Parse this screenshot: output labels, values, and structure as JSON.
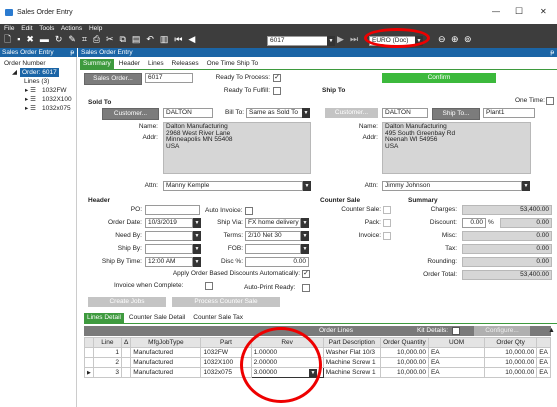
{
  "window": {
    "title": "Sales Order Entry",
    "min": "—",
    "max": "☐",
    "close": "✕"
  },
  "menu": [
    "File",
    "Edit",
    "Tools",
    "Actions",
    "Help"
  ],
  "toolbar": {
    "order_num": "6017",
    "currency": "EURO (Doc)"
  },
  "tree": {
    "header": "Sales Order Entry",
    "pin": "ᵽ",
    "order_number": "Order Number",
    "order": "Order: 6017",
    "lines": "Lines (3)",
    "items": [
      "1032FW",
      "1032X100",
      "1032x075"
    ]
  },
  "main": {
    "header": "Sales Order Entry",
    "pin": "ᵽ"
  },
  "tabs": [
    "Summary",
    "Header",
    "Lines",
    "Releases",
    "One Time Ship To"
  ],
  "top": {
    "sales_order_btn": "Sales Order...",
    "sales_order": "6017",
    "ready_to_process": "Ready To Process:",
    "ready_to_fulfill": "Ready To Fulfill:",
    "confirm": "Confirm",
    "check": "✓"
  },
  "sold_to": {
    "title": "Sold To",
    "customer_btn": "Customer...",
    "customer": "DALTON",
    "bill_to_label": "Bill To:",
    "bill_to": "Same as Sold To",
    "name_label": "Name:",
    "name": "Dalton Manufacturing",
    "addr_label": "Addr:",
    "addr1": "2968 West River Lane",
    "addr2": "Minneapolis MN 55408",
    "addr3": "USA",
    "attn_label": "Attn:",
    "attn": "Manny Kemple"
  },
  "ship_to": {
    "title": "Ship To",
    "one_time": "One Time:",
    "customer_btn": "Customer...",
    "customer": "DALTON",
    "ship_to_btn": "Ship To...",
    "ship_to": "Plant1",
    "name_label": "Name:",
    "name": "Dalton Manufacturing",
    "addr_label": "Addr:",
    "addr1": "495 South Greenbay Rd",
    "addr2": "Neenah WI 54956",
    "addr3": "USA",
    "attn_label": "Attn:",
    "attn": "Jimmy Johnson"
  },
  "header": {
    "title": "Header",
    "po_label": "PO:",
    "po": "",
    "auto_invoice": "Auto Invoice:",
    "order_date_label": "Order Date:",
    "order_date": "10/3/2019",
    "ship_via_label": "Ship Via:",
    "ship_via": "FX home delivery",
    "need_by_label": "Need By:",
    "terms_label": "Terms:",
    "terms": "2/10 Net 30",
    "ship_by_label": "Ship By:",
    "fob_label": "FOB:",
    "ship_by_time_label": "Ship By Time:",
    "ship_by_time": "12:00 AM",
    "disc_label": "Disc %:",
    "disc": "0.00",
    "apply_discounts": "Apply Order Based Discounts Automatically:",
    "invoice_when_complete": "Invoice when Complete:",
    "auto_print": "Auto-Print Ready:"
  },
  "counter_sale": {
    "title": "Counter Sale",
    "counter_sale": "Counter Sale:",
    "pack": "Pack:",
    "invoice": "Invoice:"
  },
  "summary": {
    "title": "Summary",
    "charges_label": "Charges:",
    "charges": "53,400.00",
    "discount_label": "Discount:",
    "discount_pct": "0.00",
    "pct": "%",
    "discount": "0.00",
    "misc_label": "Misc:",
    "misc": "0.00",
    "tax_label": "Tax:",
    "tax": "0.00",
    "rounding_label": "Rounding:",
    "rounding": "0.00",
    "order_total_label": "Order Total:",
    "order_total": "53,400.00"
  },
  "buttons": {
    "create_jobs": "Create Jobs",
    "process_counter_sale": "Process Counter Sale"
  },
  "lower_tabs": [
    "Lines Detail",
    "Counter Sale Detail",
    "Counter Sale Tax"
  ],
  "lines": {
    "title": "Order Lines",
    "kit_details": "Kit Details:",
    "configure": "Configure...",
    "columns": [
      "Line",
      "Δ",
      "MfgJobType",
      "Part",
      "Rev",
      "Part Description",
      "Order Quantity",
      "UOM",
      "Order Qty",
      ""
    ],
    "rows": [
      {
        "line": "1",
        "type": "Manufactured",
        "part": "1032FW",
        "rev": "1.00000",
        "desc": "Washer Flat 10/3",
        "qty": "10,000.00",
        "uom": "EA",
        "oqty": "10,000.00",
        "ouom": "EA"
      },
      {
        "line": "2",
        "type": "Manufactured",
        "part": "1032X100",
        "rev": "2.00000",
        "desc": "Machine Screw 1",
        "qty": "10,000.00",
        "uom": "EA",
        "oqty": "10,000.00",
        "ouom": "EA"
      },
      {
        "line": "3",
        "type": "Manufactured",
        "part": "1032x075",
        "rev": "3.00000",
        "desc": "Machine Screw 1",
        "qty": "10,000.00",
        "uom": "EA",
        "oqty": "10,000.00",
        "ouom": "EA"
      }
    ]
  }
}
